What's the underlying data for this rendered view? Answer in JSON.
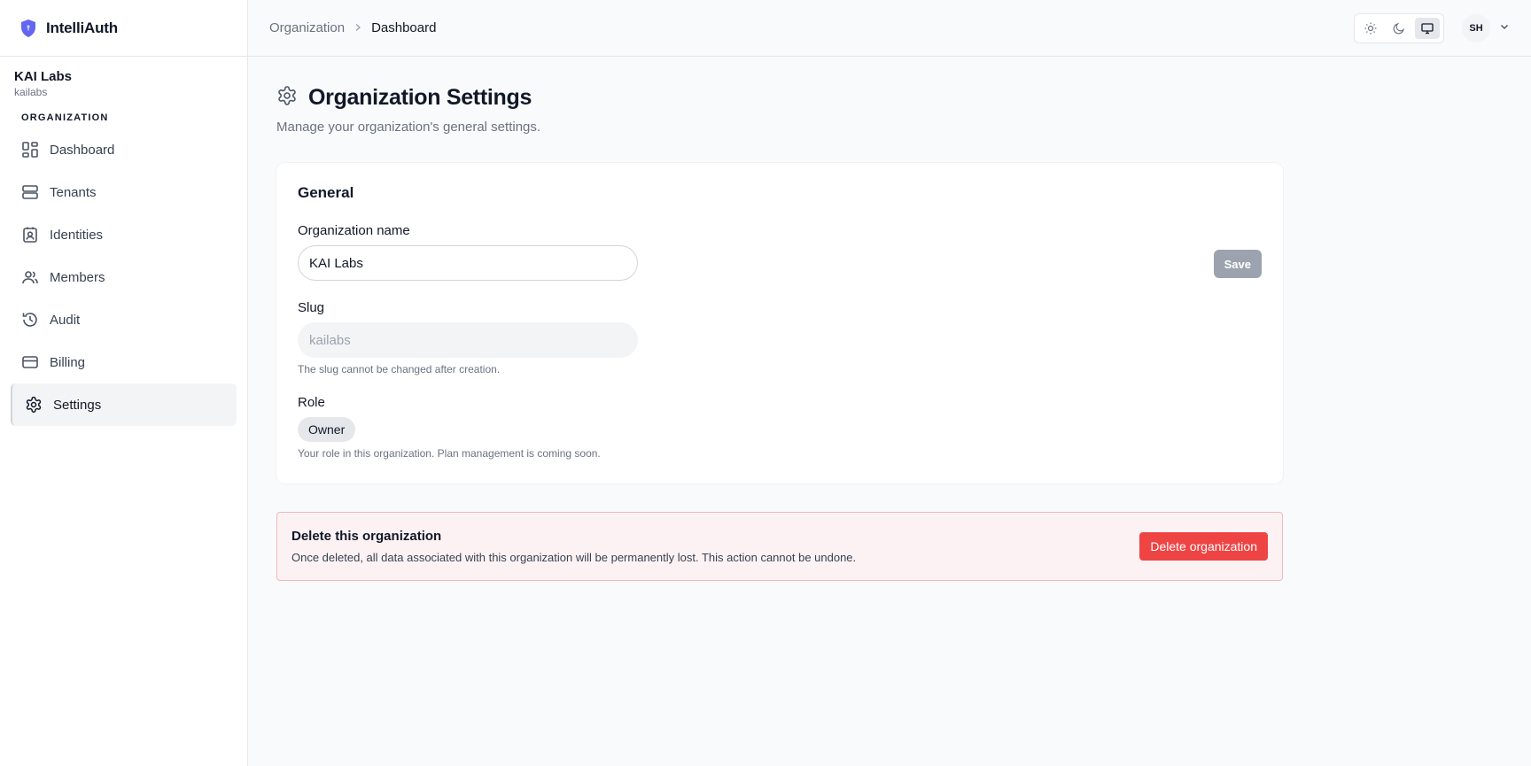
{
  "app": {
    "name": "IntelliAuth"
  },
  "organization": {
    "name": "KAI Labs",
    "slug": "kailabs"
  },
  "sidebar": {
    "section_label": "ORGANIZATION",
    "items": [
      {
        "label": "Dashboard",
        "icon": "dashboard-icon"
      },
      {
        "label": "Tenants",
        "icon": "server-icon"
      },
      {
        "label": "Identities",
        "icon": "contact-icon"
      },
      {
        "label": "Members",
        "icon": "users-icon"
      },
      {
        "label": "Audit",
        "icon": "history-icon"
      },
      {
        "label": "Billing",
        "icon": "credit-card-icon"
      },
      {
        "label": "Settings",
        "icon": "gear-icon",
        "active": true
      }
    ]
  },
  "header": {
    "breadcrumb": [
      "Organization",
      "Dashboard"
    ],
    "theme_options": [
      "light",
      "dark",
      "system"
    ],
    "theme_selected": "system",
    "user_initials": "SH"
  },
  "page": {
    "title": "Organization Settings",
    "subtitle": "Manage your organization's general settings."
  },
  "general": {
    "title": "General",
    "name_label": "Organization name",
    "name_value": "KAI Labs",
    "save_label": "Save",
    "slug_label": "Slug",
    "slug_value": "kailabs",
    "slug_hint": "The slug cannot be changed after creation.",
    "role_label": "Role",
    "role_value": "Owner",
    "role_hint": "Your role in this organization. Plan management is coming soon."
  },
  "danger": {
    "title": "Delete this organization",
    "description": "Once deleted, all data associated with this organization will be permanently lost. This action cannot be undone.",
    "button_label": "Delete organization"
  },
  "colors": {
    "brand": "#6366f1",
    "danger": "#ef4444",
    "danger_bg": "#fdf2f3",
    "save_disabled": "#9ca3af"
  }
}
